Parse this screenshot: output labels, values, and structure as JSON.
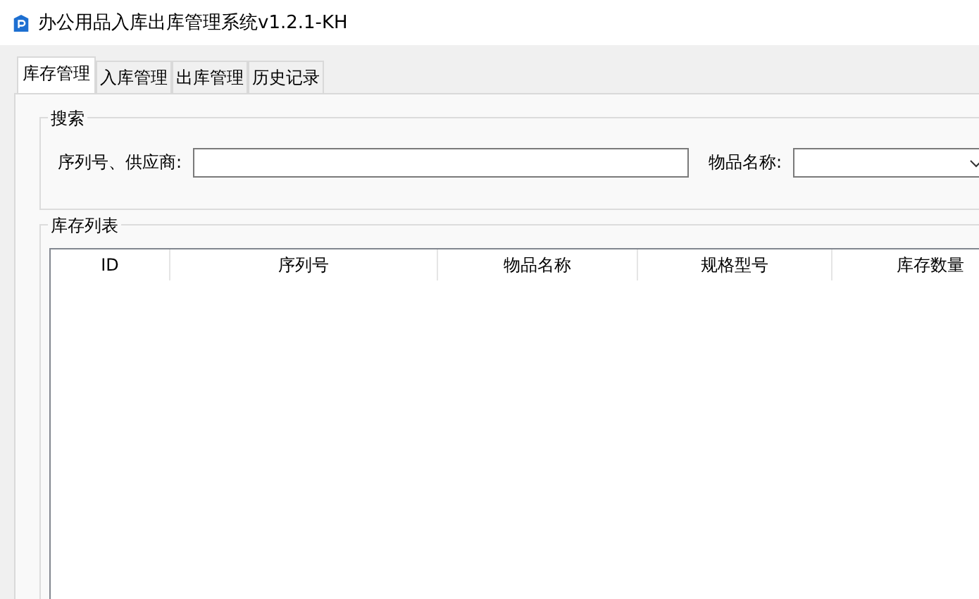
{
  "window": {
    "title": "办公用品入库出库管理系统v1.2.1-KH"
  },
  "tabs": [
    {
      "label": "库存管理",
      "selected": true
    },
    {
      "label": "入库管理",
      "selected": false
    },
    {
      "label": "出库管理",
      "selected": false
    },
    {
      "label": "历史记录",
      "selected": false
    }
  ],
  "search": {
    "title": "搜索",
    "serial_label": "序列号、供应商:",
    "name_label": "物品名称:"
  },
  "inventory": {
    "title": "库存列表",
    "columns": [
      "ID",
      "序列号",
      "物品名称",
      "规格型号",
      "库存数量"
    ]
  }
}
